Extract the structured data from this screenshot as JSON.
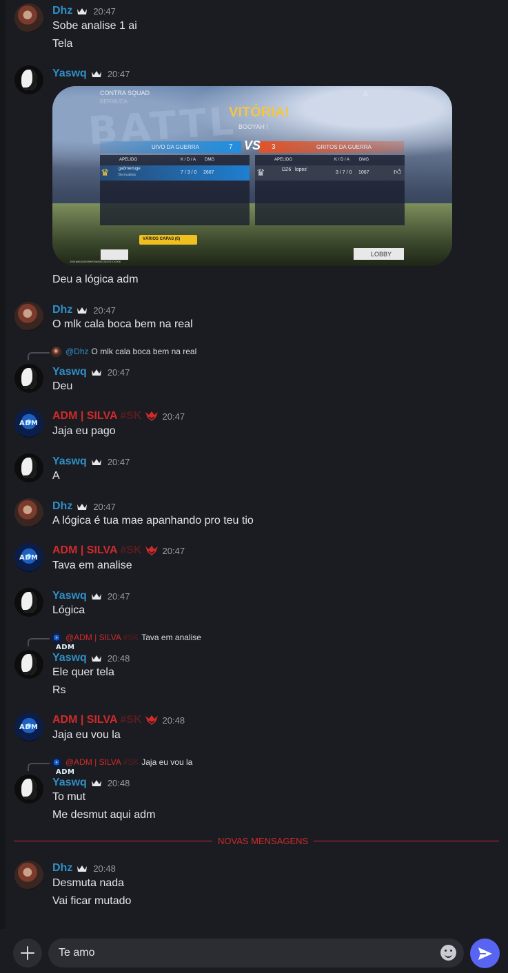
{
  "messages": [
    {
      "author": "Dhz",
      "time": "20:47",
      "lines": [
        "Sobe analise 1 ai",
        "Tela"
      ]
    },
    {
      "author": "Yaswq",
      "time": "20:47",
      "lines": [
        "Deu a lógica adm"
      ]
    },
    {
      "author": "Dhz",
      "time": "20:47",
      "lines": [
        "O mlk cala boca bem na real"
      ]
    },
    {
      "author": "Yaswq",
      "time": "20:47",
      "lines": [
        "Deu"
      ],
      "reply": {
        "to": "@Dhz",
        "text": "O mlk cala boca bem na real"
      }
    },
    {
      "author": "ADM | SILVA #SK",
      "time": "20:47",
      "lines": [
        "Jaja eu pago"
      ]
    },
    {
      "author": "Yaswq",
      "time": "20:47",
      "lines": [
        "A"
      ]
    },
    {
      "author": "Dhz",
      "time": "20:47",
      "lines": [
        "A lógica é tua mae apanhando pro teu tio"
      ]
    },
    {
      "author": "ADM | SILVA #SK",
      "time": "20:47",
      "lines": [
        "Tava em analise"
      ]
    },
    {
      "author": "Yaswq",
      "time": "20:47",
      "lines": [
        "Lógica"
      ]
    },
    {
      "author": "Yaswq",
      "time": "20:48",
      "lines": [
        "Ele quer tela",
        "Rs"
      ],
      "reply": {
        "to": "@ADM | SILVA #SK",
        "text": "Tava em analise"
      }
    },
    {
      "author": "ADM | SILVA #SK",
      "time": "20:48",
      "lines": [
        "Jaja eu vou la"
      ]
    },
    {
      "author": "Yaswq",
      "time": "20:48",
      "lines": [
        "To mut",
        "Me desmut aqui adm"
      ],
      "reply": {
        "to": "@ADM | SILVA #SK",
        "text": "Jaja eu vou la"
      }
    },
    {
      "author": "Dhz",
      "time": "20:48",
      "lines": [
        "Desmuta nada",
        "Vai ficar mutado"
      ]
    }
  ],
  "author_names": {
    "dhz": "Dhz",
    "yaswq": "Yaswq",
    "adm_main": "ADM | SILVA",
    "adm_tag": "#SK",
    "reply_dhz": "@Dhz",
    "reply_adm_main": "@ADM | SILVA",
    "reply_adm_tag": "#SK"
  },
  "embed": {
    "mode": "CONTRA SQUAD",
    "map": "BERMUDA",
    "result": "VITÓRIA!",
    "subtitle": "BOOYAH !",
    "vs": "VS",
    "team_left": "UIVO DA GUERRA",
    "team_left_score": "7",
    "team_right": "GRITOS DA GUERRA",
    "team_right_score": "3",
    "col_apelido": "APELIDO",
    "col_kda": "K / D / A",
    "col_dmg": "DMG",
    "player_left": "gaômerluge",
    "player_left_sub": "Bermudinis",
    "player_left_kda": "7 / 3 / 0",
    "player_left_dmg": "2667",
    "player_right": "DZ6",
    "player_right_name": "lopes'",
    "player_right_kda": "3 / 7 / 0",
    "player_right_dmg": "1067",
    "capas": "VÁRIOS CAPAS (6)",
    "lobby": "LOBBY",
    "match_id": "1991866334399990084987245767C0006"
  },
  "divider": "NOVAS MENSAGENS",
  "composer": {
    "value": "Te amo"
  },
  "colors": {
    "bg": "#1b1c21",
    "name_blue": "#2f8fc7",
    "name_red": "#d12a2a",
    "accent": "#5865f2"
  }
}
